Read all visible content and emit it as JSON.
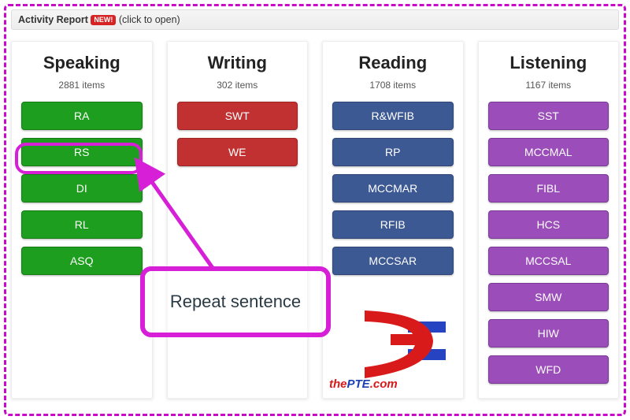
{
  "report_bar": {
    "title": "Activity Report",
    "badge": "NEW!",
    "hint": "(click to open)"
  },
  "columns": [
    {
      "title": "Speaking",
      "count": "2881 items",
      "color": "green",
      "buttons": [
        "RA",
        "RS",
        "DI",
        "RL",
        "ASQ"
      ]
    },
    {
      "title": "Writing",
      "count": "302 items",
      "color": "red",
      "buttons": [
        "SWT",
        "WE"
      ]
    },
    {
      "title": "Reading",
      "count": "1708 items",
      "color": "blue",
      "buttons": [
        "R&WFIB",
        "RP",
        "MCCMAR",
        "RFIB",
        "MCCSAR"
      ]
    },
    {
      "title": "Listening",
      "count": "1167 items",
      "color": "purple",
      "buttons": [
        "SST",
        "MCCMAL",
        "FIBL",
        "HCS",
        "MCCSAL",
        "SMW",
        "HIW",
        "WFD"
      ]
    }
  ],
  "callout": {
    "text": "Repeat sentence"
  },
  "logo": {
    "text_prefix": "the",
    "text_main": "PTE",
    "text_suffix": ".com"
  }
}
